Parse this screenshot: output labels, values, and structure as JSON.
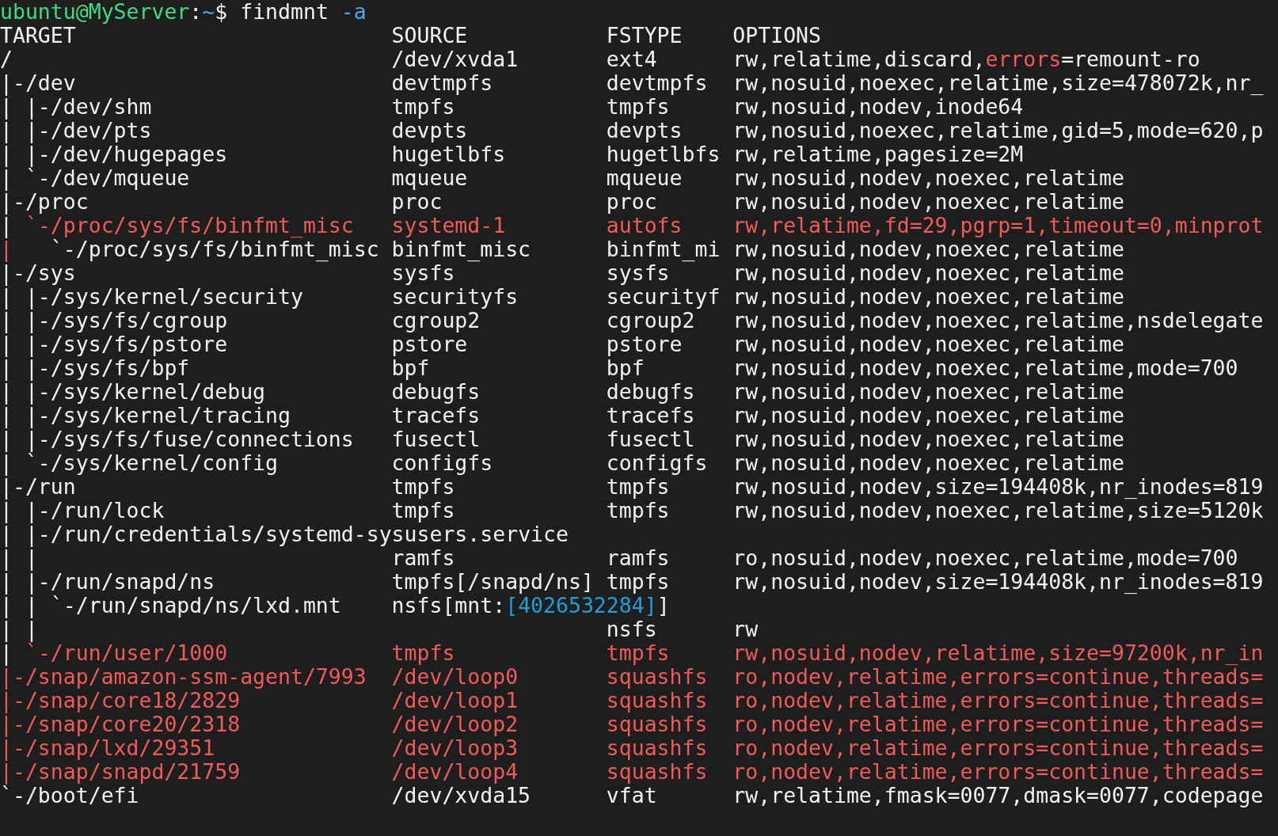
{
  "prompt": {
    "user_host": "ubuntu@MyServer",
    "separator": ":",
    "path": "~",
    "symbol": "$",
    "command": "findmnt",
    "flag": "-a"
  },
  "columns": [
    "TARGET",
    "SOURCE",
    "FSTYPE",
    "OPTIONS"
  ],
  "rows": [
    {
      "target": [
        "/"
      ],
      "source": [
        "/dev/xvda1"
      ],
      "fstype": [
        "ext4"
      ],
      "options": [
        "rw,relatime,discard,",
        {
          "text": "errors",
          "kind": "alert"
        },
        "=remount-ro"
      ]
    },
    {
      "target": [
        "|-/dev"
      ],
      "source": [
        "devtmpfs"
      ],
      "fstype": [
        "devtmpfs"
      ],
      "options": [
        "rw,nosuid,noexec,relatime,size=478072k,nr_"
      ]
    },
    {
      "target": [
        "| |-/dev/shm"
      ],
      "source": [
        "tmpfs"
      ],
      "fstype": [
        "tmpfs"
      ],
      "options": [
        "rw,nosuid,nodev,inode64"
      ]
    },
    {
      "target": [
        "| |-/dev/pts"
      ],
      "source": [
        "devpts"
      ],
      "fstype": [
        "devpts"
      ],
      "options": [
        "rw,nosuid,noexec,relatime,gid=5,mode=620,p"
      ]
    },
    {
      "target": [
        "| |-/dev/hugepages"
      ],
      "source": [
        "hugetlbfs"
      ],
      "fstype": [
        "hugetlbfs"
      ],
      "options": [
        "rw,relatime,pagesize=2M"
      ]
    },
    {
      "target": [
        "| `-/dev/mqueue"
      ],
      "source": [
        "mqueue"
      ],
      "fstype": [
        "mqueue"
      ],
      "options": [
        "rw,nosuid,nodev,noexec,relatime"
      ]
    },
    {
      "target": [
        "|-/proc"
      ],
      "source": [
        "proc"
      ],
      "fstype": [
        "proc"
      ],
      "options": [
        "rw,nosuid,nodev,noexec,relatime"
      ]
    },
    {
      "target": [
        "| ",
        {
          "text": "`-/proc/sys/fs/binfmt_misc",
          "kind": "alert"
        }
      ],
      "source": [
        {
          "text": "systemd-1",
          "kind": "alert"
        }
      ],
      "fstype": [
        {
          "text": "autofs",
          "kind": "alert"
        }
      ],
      "options": [
        {
          "text": "rw,relatime,fd=29,pgrp=1,timeout=0,minprot",
          "kind": "alert"
        }
      ]
    },
    {
      "target": [
        {
          "text": "|",
          "kind": "alert"
        },
        "   `-/proc/sys/fs/binfmt_misc"
      ],
      "source": [
        "binfmt_misc"
      ],
      "fstype": [
        "binfmt_mi"
      ],
      "options": [
        "rw,nosuid,nodev,noexec,relatime"
      ]
    },
    {
      "target": [
        "|-/sys"
      ],
      "source": [
        "sysfs"
      ],
      "fstype": [
        "sysfs"
      ],
      "options": [
        "rw,nosuid,nodev,noexec,relatime"
      ]
    },
    {
      "target": [
        "| |-/sys/kernel/security"
      ],
      "source": [
        "securityfs"
      ],
      "fstype": [
        "securityf"
      ],
      "options": [
        "rw,nosuid,nodev,noexec,relatime"
      ]
    },
    {
      "target": [
        "| |-/sys/fs/cgroup"
      ],
      "source": [
        "cgroup2"
      ],
      "fstype": [
        "cgroup2"
      ],
      "options": [
        "rw,nosuid,nodev,noexec,relatime,nsdelegate"
      ]
    },
    {
      "target": [
        "| |-/sys/fs/pstore"
      ],
      "source": [
        "pstore"
      ],
      "fstype": [
        "pstore"
      ],
      "options": [
        "rw,nosuid,nodev,noexec,relatime"
      ]
    },
    {
      "target": [
        "| |-/sys/fs/bpf"
      ],
      "source": [
        "bpf"
      ],
      "fstype": [
        "bpf"
      ],
      "options": [
        "rw,nosuid,nodev,noexec,relatime,mode=700"
      ]
    },
    {
      "target": [
        "| |-/sys/kernel/debug"
      ],
      "source": [
        "debugfs"
      ],
      "fstype": [
        "debugfs"
      ],
      "options": [
        "rw,nosuid,nodev,noexec,relatime"
      ]
    },
    {
      "target": [
        "| |-/sys/kernel/tracing"
      ],
      "source": [
        "tracefs"
      ],
      "fstype": [
        "tracefs"
      ],
      "options": [
        "rw,nosuid,nodev,noexec,relatime"
      ]
    },
    {
      "target": [
        "| |-/sys/fs/fuse/connections"
      ],
      "source": [
        "fusectl"
      ],
      "fstype": [
        "fusectl"
      ],
      "options": [
        "rw,nosuid,nodev,noexec,relatime"
      ]
    },
    {
      "target": [
        "| `-/sys/kernel/config"
      ],
      "source": [
        "configfs"
      ],
      "fstype": [
        "configfs"
      ],
      "options": [
        "rw,nosuid,nodev,noexec,relatime"
      ]
    },
    {
      "target": [
        "|-/run"
      ],
      "source": [
        "tmpfs"
      ],
      "fstype": [
        "tmpfs"
      ],
      "options": [
        "rw,nosuid,nodev,size=194408k,nr_inodes=819"
      ]
    },
    {
      "target": [
        "| |-/run/lock"
      ],
      "source": [
        "tmpfs"
      ],
      "fstype": [
        "tmpfs"
      ],
      "options": [
        "rw,nosuid,nodev,noexec,relatime,size=5120k"
      ]
    },
    {
      "target": [
        "| |-/run/credentials/systemd-sysusers.service"
      ]
    },
    {
      "target": [
        "| |"
      ],
      "source": [
        "ramfs"
      ],
      "fstype": [
        "ramfs"
      ],
      "options": [
        "ro,nosuid,nodev,noexec,relatime,mode=700"
      ]
    },
    {
      "target": [
        "| |-/run/snapd/ns"
      ],
      "source": [
        "tmpfs[/snapd/ns]"
      ],
      "fstype": [
        "tmpfs"
      ],
      "options": [
        "rw,nosuid,nodev,size=194408k,nr_inodes=819"
      ]
    },
    {
      "target": [
        "| | `-/run/snapd/ns/lxd.mnt"
      ],
      "source": [
        "nsfs[mnt:",
        {
          "text": "[4026532284]",
          "kind": "number"
        },
        "]"
      ]
    },
    {
      "target": [
        "| |"
      ],
      "fstype": [
        "nsfs"
      ],
      "options": [
        "rw"
      ]
    },
    {
      "target": [
        "| ",
        {
          "text": "`-/run/user/1000",
          "kind": "alert"
        }
      ],
      "source": [
        {
          "text": "tmpfs",
          "kind": "alert"
        }
      ],
      "fstype": [
        {
          "text": "tmpfs",
          "kind": "alert"
        }
      ],
      "options": [
        {
          "text": "rw,nosuid,nodev,relatime,size=97200k,nr_in",
          "kind": "alert"
        }
      ]
    },
    {
      "target": [
        {
          "text": "|-/snap/amazon-ssm-agent/7993",
          "kind": "alert"
        }
      ],
      "source": [
        {
          "text": "/dev/loop0",
          "kind": "alert"
        }
      ],
      "fstype": [
        {
          "text": "squashfs",
          "kind": "alert"
        }
      ],
      "options": [
        {
          "text": "ro,nodev,relatime,errors=continue,threads=",
          "kind": "alert"
        }
      ]
    },
    {
      "target": [
        {
          "text": "|-/snap/core18/2829",
          "kind": "alert"
        }
      ],
      "source": [
        {
          "text": "/dev/loop1",
          "kind": "alert"
        }
      ],
      "fstype": [
        {
          "text": "squashfs",
          "kind": "alert"
        }
      ],
      "options": [
        {
          "text": "ro,nodev,relatime,errors=continue,threads=",
          "kind": "alert"
        }
      ]
    },
    {
      "target": [
        {
          "text": "|-/snap/core20/2318",
          "kind": "alert"
        }
      ],
      "source": [
        {
          "text": "/dev/loop2",
          "kind": "alert"
        }
      ],
      "fstype": [
        {
          "text": "squashfs",
          "kind": "alert"
        }
      ],
      "options": [
        {
          "text": "ro,nodev,relatime,errors=continue,threads=",
          "kind": "alert"
        }
      ]
    },
    {
      "target": [
        {
          "text": "|-/snap/lxd/29351",
          "kind": "alert"
        }
      ],
      "source": [
        {
          "text": "/dev/loop3",
          "kind": "alert"
        }
      ],
      "fstype": [
        {
          "text": "squashfs",
          "kind": "alert"
        }
      ],
      "options": [
        {
          "text": "ro,nodev,relatime,errors=continue,threads=",
          "kind": "alert"
        }
      ]
    },
    {
      "target": [
        {
          "text": "|-/snap/snapd/21759",
          "kind": "alert"
        }
      ],
      "source": [
        {
          "text": "/dev/loop4",
          "kind": "alert"
        }
      ],
      "fstype": [
        {
          "text": "squashfs",
          "kind": "alert"
        }
      ],
      "options": [
        {
          "text": "ro,nodev,relatime,errors=continue,threads=",
          "kind": "alert"
        }
      ]
    },
    {
      "target": [
        "`-/boot/efi"
      ],
      "source": [
        "/dev/xvda15"
      ],
      "fstype": [
        "vfat"
      ],
      "options": [
        "rw,relatime,fmask=0077,dmask=0077,codepage"
      ]
    }
  ]
}
